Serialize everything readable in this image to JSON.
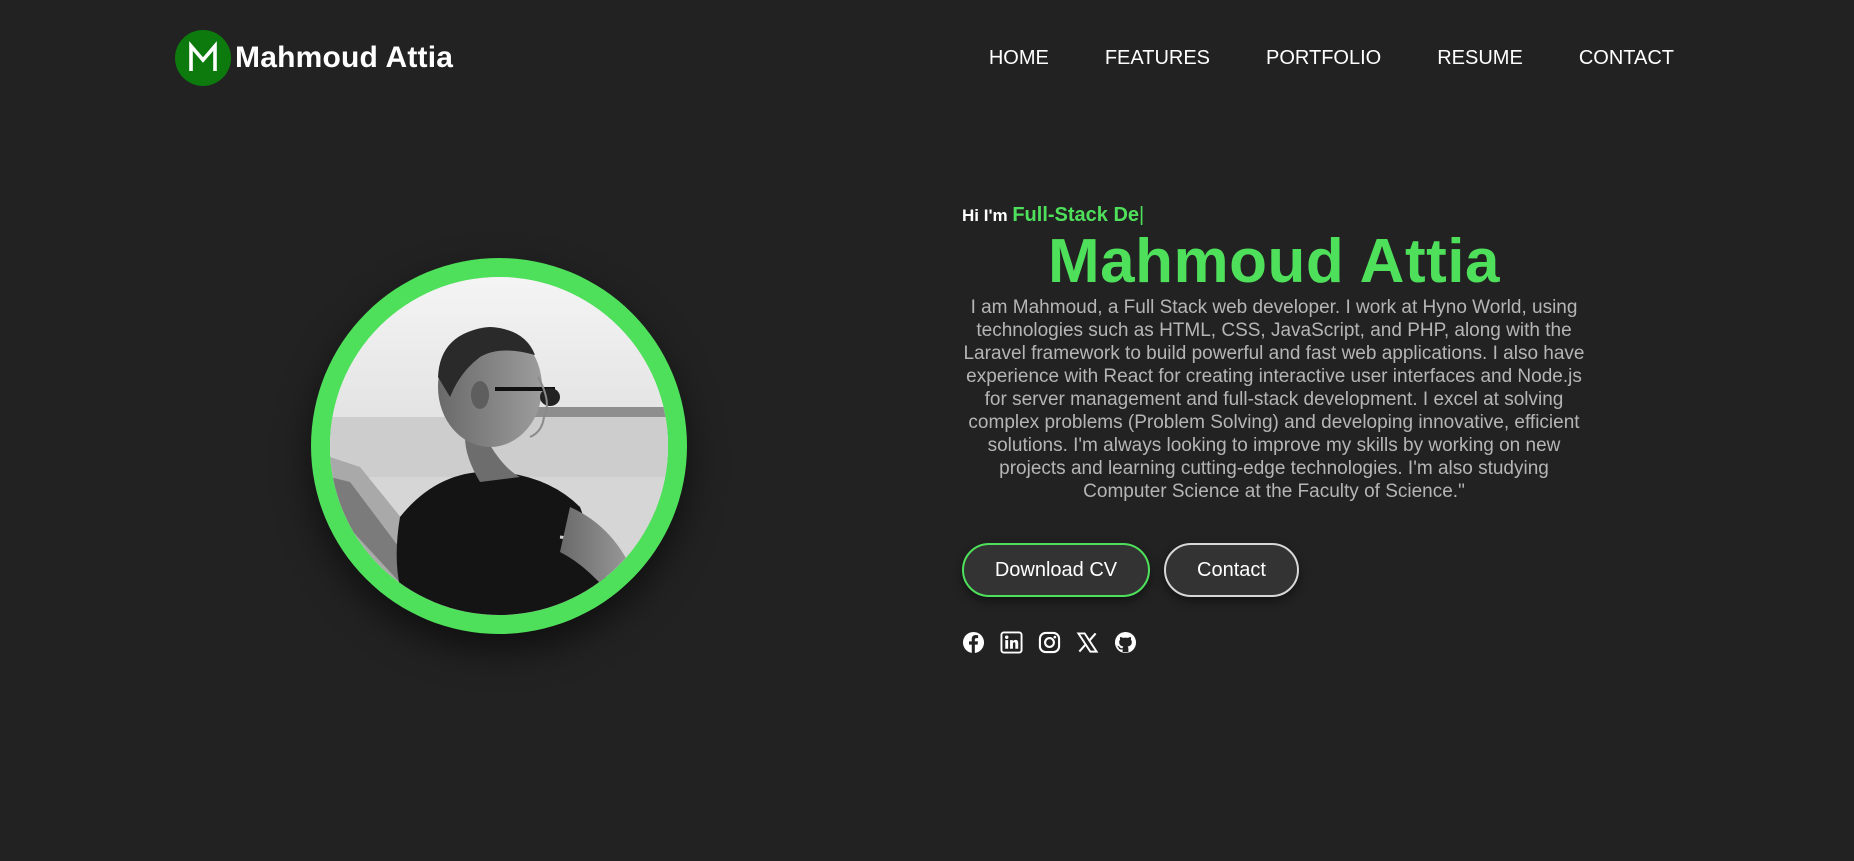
{
  "header": {
    "logo_letter": "M",
    "brand_name": "Mahmoud Attia",
    "nav": [
      {
        "label": "HOME"
      },
      {
        "label": "FEATURES"
      },
      {
        "label": "PORTFOLIO"
      },
      {
        "label": "RESUME"
      },
      {
        "label": "CONTACT"
      }
    ]
  },
  "hero": {
    "greeting_prefix": "Hi I'm",
    "typed_role": "Full-Stack De",
    "cursor": "|",
    "name": "Mahmoud Attia",
    "bio": "I am Mahmoud, a Full Stack web developer. I work at Hyno World, using technologies such as HTML, CSS, JavaScript, and PHP, along with the Laravel framework to build powerful and fast web applications. I also have experience with React for creating interactive user interfaces and Node.js for server management and full-stack development. I excel at solving complex problems (Problem Solving) and developing innovative, efficient solutions. I'm always looking to improve my skills by working on new projects and learning cutting-edge technologies. I'm also studying Computer Science at the Faculty of Science.\"",
    "buttons": {
      "download_cv": "Download CV",
      "contact": "Contact"
    },
    "social_icons": [
      "facebook-icon",
      "linkedin-icon",
      "instagram-icon",
      "x-icon",
      "github-icon"
    ]
  },
  "colors": {
    "background": "#222222",
    "accent": "#4fe05b",
    "logo_bg": "#0c7a0c",
    "bio_text": "#b5b5b5",
    "button_bg": "#333333"
  }
}
